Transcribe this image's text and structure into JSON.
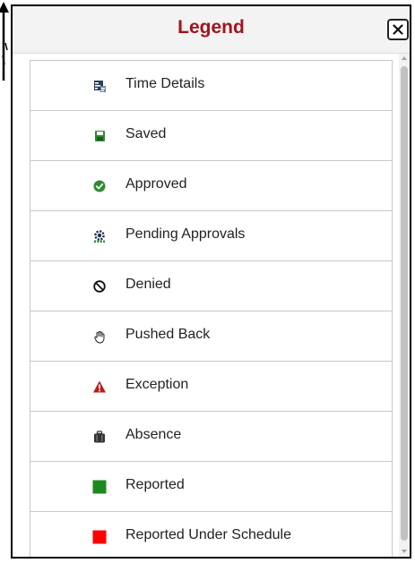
{
  "modal": {
    "title": "Legend",
    "close_icon": "close-icon",
    "title_color": "#a0141e"
  },
  "legend": {
    "items": [
      {
        "label": "Time Details",
        "icon": "time-details-icon"
      },
      {
        "label": "Saved",
        "icon": "saved-icon",
        "color": "#2e8b2e"
      },
      {
        "label": "Approved",
        "icon": "approved-icon",
        "color": "#2e8b2e"
      },
      {
        "label": "Pending Approvals",
        "icon": "pending-approvals-icon"
      },
      {
        "label": "Denied",
        "icon": "denied-icon"
      },
      {
        "label": "Pushed Back",
        "icon": "pushed-back-icon"
      },
      {
        "label": "Exception",
        "icon": "exception-icon",
        "color": "#c01818"
      },
      {
        "label": "Absence",
        "icon": "absence-icon"
      },
      {
        "label": "Reported",
        "icon": "reported-icon",
        "color": "#1e8a1e"
      },
      {
        "label": "Reported Under Schedule",
        "icon": "reported-under-schedule-icon",
        "color": "#ff0000"
      }
    ]
  }
}
